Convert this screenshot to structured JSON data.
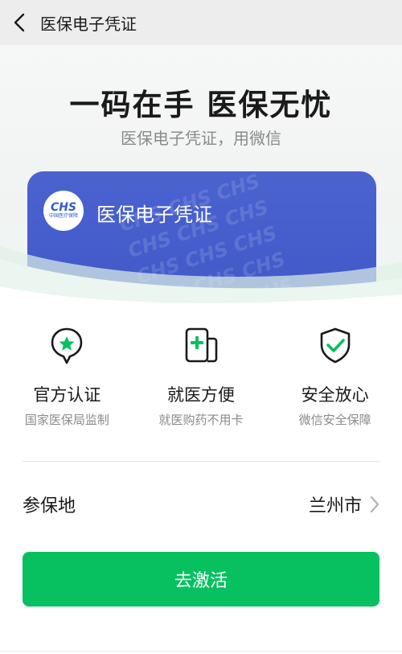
{
  "navbar": {
    "title": "医保电子凭证",
    "back_icon": "chevron-left-icon"
  },
  "hero": {
    "title": "一码在手 医保无忧",
    "subtitle": "医保电子凭证，用微信",
    "card": {
      "logo_text": "CHS",
      "logo_subtext": "中国医疗保障",
      "title": "医保电子凭证",
      "watermark": "CHS CHS CHS",
      "color": "#4360cc"
    }
  },
  "features": [
    {
      "icon": "star-badge-icon",
      "title": "官方认证",
      "subtitle": "国家医保局监制"
    },
    {
      "icon": "medical-card-icon",
      "title": "就医方便",
      "subtitle": "就医购药不用卡"
    },
    {
      "icon": "shield-check-icon",
      "title": "安全放心",
      "subtitle": "微信安全保障"
    }
  ],
  "region": {
    "label": "参保地",
    "value": "兰州市",
    "chevron_icon": "chevron-right-icon"
  },
  "activate_button": {
    "label": "去激活",
    "color": "#07c160"
  },
  "colors": {
    "accent": "#07c160",
    "card_blue": "#4360cc",
    "text_secondary": "#8a8a8a"
  }
}
